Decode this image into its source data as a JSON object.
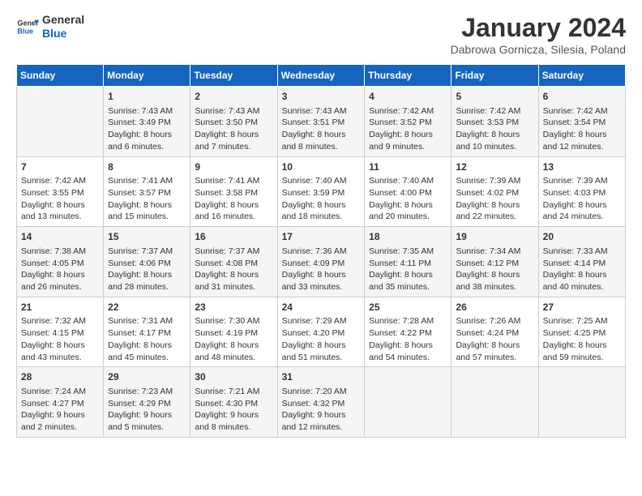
{
  "logo": {
    "text_general": "General",
    "text_blue": "Blue"
  },
  "title": "January 2024",
  "subtitle": "Dabrowa Gornicza, Silesia, Poland",
  "days_of_week": [
    "Sunday",
    "Monday",
    "Tuesday",
    "Wednesday",
    "Thursday",
    "Friday",
    "Saturday"
  ],
  "weeks": [
    [
      {
        "day": "",
        "content": ""
      },
      {
        "day": "1",
        "content": "Sunrise: 7:43 AM\nSunset: 3:49 PM\nDaylight: 8 hours\nand 6 minutes."
      },
      {
        "day": "2",
        "content": "Sunrise: 7:43 AM\nSunset: 3:50 PM\nDaylight: 8 hours\nand 7 minutes."
      },
      {
        "day": "3",
        "content": "Sunrise: 7:43 AM\nSunset: 3:51 PM\nDaylight: 8 hours\nand 8 minutes."
      },
      {
        "day": "4",
        "content": "Sunrise: 7:42 AM\nSunset: 3:52 PM\nDaylight: 8 hours\nand 9 minutes."
      },
      {
        "day": "5",
        "content": "Sunrise: 7:42 AM\nSunset: 3:53 PM\nDaylight: 8 hours\nand 10 minutes."
      },
      {
        "day": "6",
        "content": "Sunrise: 7:42 AM\nSunset: 3:54 PM\nDaylight: 8 hours\nand 12 minutes."
      }
    ],
    [
      {
        "day": "7",
        "content": "Sunrise: 7:42 AM\nSunset: 3:55 PM\nDaylight: 8 hours\nand 13 minutes."
      },
      {
        "day": "8",
        "content": "Sunrise: 7:41 AM\nSunset: 3:57 PM\nDaylight: 8 hours\nand 15 minutes."
      },
      {
        "day": "9",
        "content": "Sunrise: 7:41 AM\nSunset: 3:58 PM\nDaylight: 8 hours\nand 16 minutes."
      },
      {
        "day": "10",
        "content": "Sunrise: 7:40 AM\nSunset: 3:59 PM\nDaylight: 8 hours\nand 18 minutes."
      },
      {
        "day": "11",
        "content": "Sunrise: 7:40 AM\nSunset: 4:00 PM\nDaylight: 8 hours\nand 20 minutes."
      },
      {
        "day": "12",
        "content": "Sunrise: 7:39 AM\nSunset: 4:02 PM\nDaylight: 8 hours\nand 22 minutes."
      },
      {
        "day": "13",
        "content": "Sunrise: 7:39 AM\nSunset: 4:03 PM\nDaylight: 8 hours\nand 24 minutes."
      }
    ],
    [
      {
        "day": "14",
        "content": "Sunrise: 7:38 AM\nSunset: 4:05 PM\nDaylight: 8 hours\nand 26 minutes."
      },
      {
        "day": "15",
        "content": "Sunrise: 7:37 AM\nSunset: 4:06 PM\nDaylight: 8 hours\nand 28 minutes."
      },
      {
        "day": "16",
        "content": "Sunrise: 7:37 AM\nSunset: 4:08 PM\nDaylight: 8 hours\nand 31 minutes."
      },
      {
        "day": "17",
        "content": "Sunrise: 7:36 AM\nSunset: 4:09 PM\nDaylight: 8 hours\nand 33 minutes."
      },
      {
        "day": "18",
        "content": "Sunrise: 7:35 AM\nSunset: 4:11 PM\nDaylight: 8 hours\nand 35 minutes."
      },
      {
        "day": "19",
        "content": "Sunrise: 7:34 AM\nSunset: 4:12 PM\nDaylight: 8 hours\nand 38 minutes."
      },
      {
        "day": "20",
        "content": "Sunrise: 7:33 AM\nSunset: 4:14 PM\nDaylight: 8 hours\nand 40 minutes."
      }
    ],
    [
      {
        "day": "21",
        "content": "Sunrise: 7:32 AM\nSunset: 4:15 PM\nDaylight: 8 hours\nand 43 minutes."
      },
      {
        "day": "22",
        "content": "Sunrise: 7:31 AM\nSunset: 4:17 PM\nDaylight: 8 hours\nand 45 minutes."
      },
      {
        "day": "23",
        "content": "Sunrise: 7:30 AM\nSunset: 4:19 PM\nDaylight: 8 hours\nand 48 minutes."
      },
      {
        "day": "24",
        "content": "Sunrise: 7:29 AM\nSunset: 4:20 PM\nDaylight: 8 hours\nand 51 minutes."
      },
      {
        "day": "25",
        "content": "Sunrise: 7:28 AM\nSunset: 4:22 PM\nDaylight: 8 hours\nand 54 minutes."
      },
      {
        "day": "26",
        "content": "Sunrise: 7:26 AM\nSunset: 4:24 PM\nDaylight: 8 hours\nand 57 minutes."
      },
      {
        "day": "27",
        "content": "Sunrise: 7:25 AM\nSunset: 4:25 PM\nDaylight: 8 hours\nand 59 minutes."
      }
    ],
    [
      {
        "day": "28",
        "content": "Sunrise: 7:24 AM\nSunset: 4:27 PM\nDaylight: 9 hours\nand 2 minutes."
      },
      {
        "day": "29",
        "content": "Sunrise: 7:23 AM\nSunset: 4:29 PM\nDaylight: 9 hours\nand 5 minutes."
      },
      {
        "day": "30",
        "content": "Sunrise: 7:21 AM\nSunset: 4:30 PM\nDaylight: 9 hours\nand 8 minutes."
      },
      {
        "day": "31",
        "content": "Sunrise: 7:20 AM\nSunset: 4:32 PM\nDaylight: 9 hours\nand 12 minutes."
      },
      {
        "day": "",
        "content": ""
      },
      {
        "day": "",
        "content": ""
      },
      {
        "day": "",
        "content": ""
      }
    ]
  ]
}
